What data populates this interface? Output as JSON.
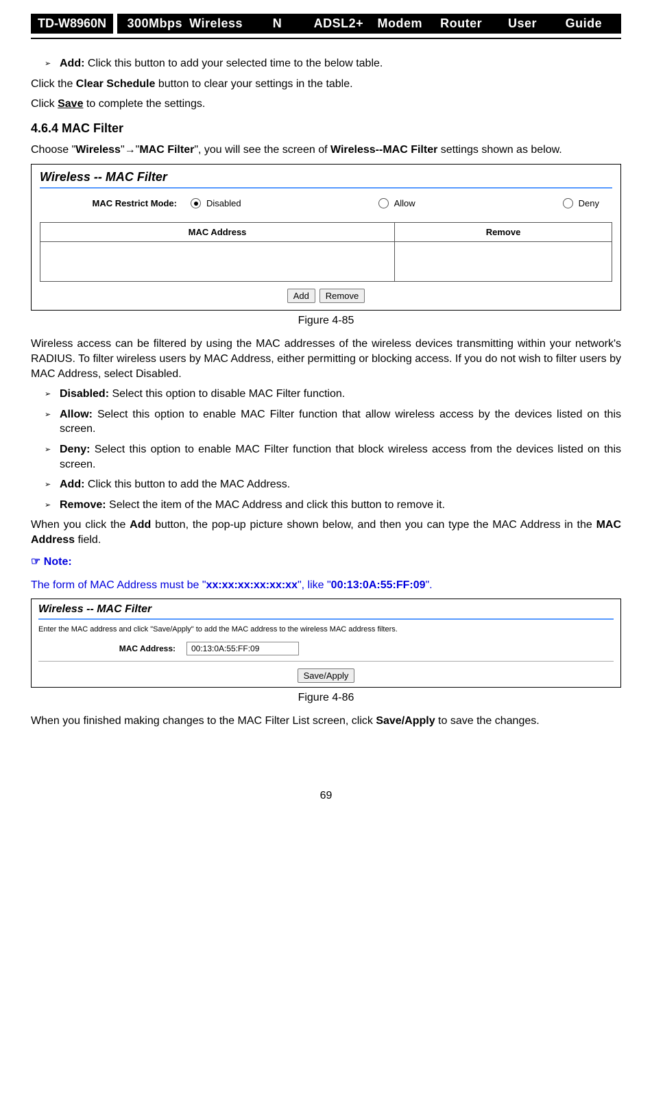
{
  "header": {
    "model": "TD-W8960N",
    "title_words": [
      "300Mbps",
      "Wireless",
      "N",
      "ADSL2+",
      "Modem",
      "Router",
      "User",
      "Guide"
    ]
  },
  "intro": {
    "add_label": "Add:",
    "add_text": " Click this button to add your selected time to the below table.",
    "clear_line_pre": "Click the ",
    "clear_bold": "Clear Schedule",
    "clear_line_post": " button to clear your settings in the table.",
    "save_line_pre": "Click ",
    "save_bold": "Save",
    "save_line_post": " to complete the settings."
  },
  "section": {
    "number_title": "4.6.4    MAC Filter",
    "nav_pre": "Choose \"",
    "nav_b1": "Wireless",
    "nav_mid": "\"→\"",
    "nav_b2": "MAC Filter",
    "nav_post1": "\", you will see the screen of ",
    "nav_b3": "Wireless--MAC Filter",
    "nav_post2": " settings shown as below."
  },
  "ss1": {
    "title": "Wireless -- MAC Filter",
    "mode_label": "MAC Restrict Mode:",
    "opt_disabled": "Disabled",
    "opt_allow": "Allow",
    "opt_deny": "Deny",
    "th_mac": "MAC Address",
    "th_remove": "Remove",
    "btn_add": "Add",
    "btn_remove": "Remove"
  },
  "fig1": "Figure 4-85",
  "para1": "Wireless access can be filtered by using the MAC addresses of the wireless devices transmitting within your network's RADIUS. To filter wireless users by MAC Address, either permitting or blocking access. If you do not wish to filter users by MAC Address, select Disabled.",
  "bullets": {
    "disabled_b": "Disabled:",
    "disabled_t": " Select this option to disable MAC Filter function.",
    "allow_b": "Allow:",
    "allow_t": " Select this option to enable MAC Filter function that allow wireless access by the devices listed on this screen.",
    "deny_b": "Deny:",
    "deny_t": " Select this option to enable MAC Filter function that block wireless access from the devices listed on this screen.",
    "add_b": "Add:",
    "add_t": " Click this button to add the MAC Address.",
    "remove_b": "Remove:",
    "remove_t": " Select the item of the MAC Address and click this button to remove it."
  },
  "para2_pre": "When you click the ",
  "para2_b1": "Add",
  "para2_mid": " button, the pop-up picture shown below, and then you can type the MAC Address in the ",
  "para2_b2": "MAC Address",
  "para2_post": " field.",
  "note": {
    "head": "☞  Note:",
    "pre": "The form of MAC Address must be \"",
    "ex1": "xx:xx:xx:xx:xx:xx",
    "mid": "\", like \"",
    "ex2": "00:13:0A:55:FF:09",
    "post": "\"."
  },
  "ss2": {
    "title": "Wireless -- MAC Filter",
    "desc": "Enter the MAC address and click \"Save/Apply\" to add the MAC address to the wireless MAC address filters.",
    "label": "MAC Address:",
    "value": "00:13:0A:55:FF:09",
    "btn": "Save/Apply"
  },
  "fig2": "Figure 4-86",
  "para3_pre": "When you finished making changes to the MAC Filter List screen, click ",
  "para3_b": "Save/Apply",
  "para3_post": " to save the changes.",
  "page": "69"
}
